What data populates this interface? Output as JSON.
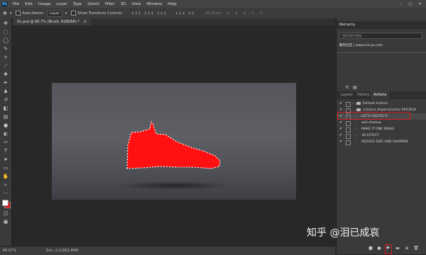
{
  "menubar": {
    "app_icon": "Ps",
    "items": [
      "File",
      "Edit",
      "Image",
      "Layer",
      "Type",
      "Select",
      "Filter",
      "3D",
      "View",
      "Window",
      "Help"
    ],
    "window_buttons": [
      "–",
      "□",
      "✕"
    ]
  },
  "options_bar": {
    "auto_select_label": "Auto-Select:",
    "auto_select_value": "Layer",
    "show_transform_label": "Show Transform Controls",
    "mode_label": "3D Mode:"
  },
  "document_tab": {
    "title": "01.psd @ 66.7% (Brush, RGB/8#) *",
    "close": "×"
  },
  "toolbar": {
    "icons": [
      "move-icon",
      "marquee-icon",
      "lasso-icon",
      "quick-select-icon",
      "crop-icon",
      "eyedropper-icon",
      "healing-icon",
      "brush-icon",
      "clone-stamp-icon",
      "history-brush-icon",
      "eraser-icon",
      "gradient-icon",
      "blur-icon",
      "dodge-icon",
      "pen-icon",
      "type-icon",
      "path-select-icon",
      "rectangle-icon",
      "hand-icon",
      "zoom-icon",
      "more-icon"
    ],
    "foreground_color": "#ffffff",
    "background_color": "#e60000"
  },
  "canvas": {
    "shoe_color": "#ff1111"
  },
  "status_bar": {
    "zoom": "66.67%",
    "doc": "Doc: 2.11M/2.86M"
  },
  "renamy_panel": {
    "title": "Renamy",
    "search_placeholder": "搜索插件面板",
    "site_text": "聚热社区 | www.mo-yu.com"
  },
  "layers_panel": {
    "tabs": [
      "Layers",
      "History",
      "Actions"
    ],
    "active_tab": "Actions",
    "actions": [
      {
        "label": "Default Actions",
        "type": "set"
      },
      {
        "label": "creative disperssionFor ERICBUX",
        "type": "set"
      },
      {
        "label": "LET'S CREATE IT",
        "type": "action",
        "highlighted": true
      },
      {
        "label": "add shadow",
        "type": "action"
      },
      {
        "label": "MAKE IT ONE IMAGE",
        "type": "action"
      },
      {
        "label": "3D EFFECT",
        "type": "action"
      },
      {
        "label": "REDUCE SIZE AND SHARPEN",
        "type": "action"
      }
    ],
    "bottom_icons": [
      "stop-icon",
      "record-icon",
      "play-icon",
      "new-set-icon",
      "new-action-icon",
      "delete-icon"
    ]
  },
  "highlight_color": "#d42020",
  "watermark": "知乎 @泪已成哀"
}
